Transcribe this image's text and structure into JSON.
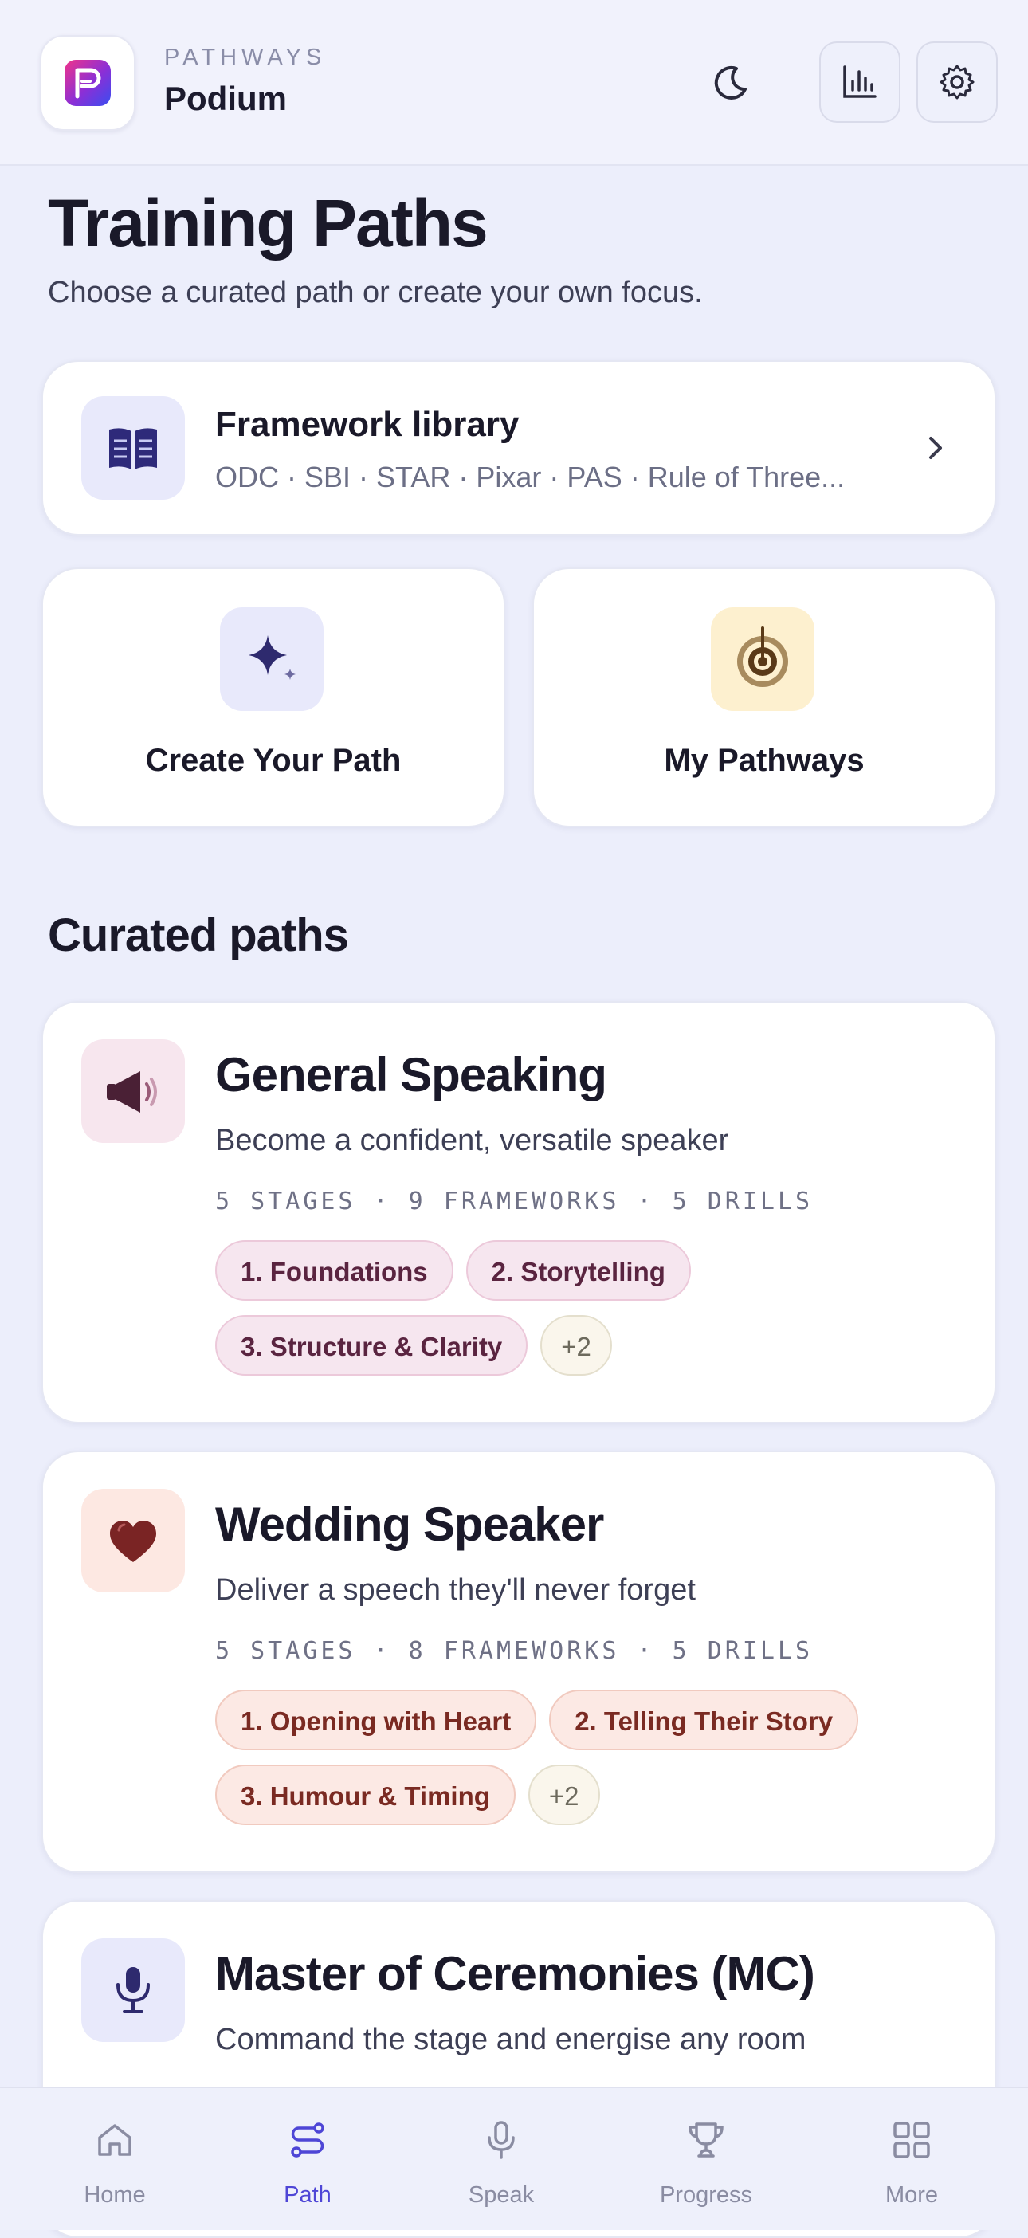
{
  "header": {
    "eyebrow": "PATHWAYS",
    "app_name": "Podium",
    "icons": [
      "app-logo",
      "moon-icon",
      "bar-chart-icon",
      "gear-icon"
    ]
  },
  "page": {
    "title": "Training Paths",
    "subtitle": "Choose a curated path or create your own focus."
  },
  "library": {
    "title": "Framework library",
    "subtitle": "ODC · SBI · STAR · Pixar · PAS · Rule of Three..."
  },
  "actions": [
    {
      "label": "Create Your Path",
      "icon": "sparkle-icon"
    },
    {
      "label": "My Pathways",
      "icon": "target-icon"
    }
  ],
  "curated": {
    "section_title": "Curated paths",
    "paths": [
      {
        "title": "General Speaking",
        "subtitle": "Become a confident, versatile speaker",
        "meta": "5 STAGES · 9 FRAMEWORKS · 5 DRILLS",
        "chips": [
          "1. Foundations",
          "2. Storytelling",
          "3. Structure & Clarity"
        ],
        "more": "+2",
        "icon": "megaphone-icon",
        "tile_color": "#f7e6ee"
      },
      {
        "title": "Wedding Speaker",
        "subtitle": "Deliver a speech they'll never forget",
        "meta": "5 STAGES · 8 FRAMEWORKS · 5 DRILLS",
        "chips": [
          "1. Opening with Heart",
          "2. Telling Their Story",
          "3. Humour & Timing"
        ],
        "more": "+2",
        "icon": "heart-icon",
        "tile_color": "#fde8e2"
      },
      {
        "title": "Master of Ceremonies (MC)",
        "subtitle": "Command the stage and energise any room",
        "icon": "microphone-icon",
        "tile_color": "#e8e9fb"
      }
    ]
  },
  "nav": {
    "active": "Path",
    "accent": "#4e46d6",
    "items": [
      {
        "label": "Home",
        "icon": "home-icon"
      },
      {
        "label": "Path",
        "icon": "path-icon"
      },
      {
        "label": "Speak",
        "icon": "microphone-icon"
      },
      {
        "label": "Progress",
        "icon": "trophy-icon"
      },
      {
        "label": "More",
        "icon": "grid-icon"
      }
    ]
  }
}
